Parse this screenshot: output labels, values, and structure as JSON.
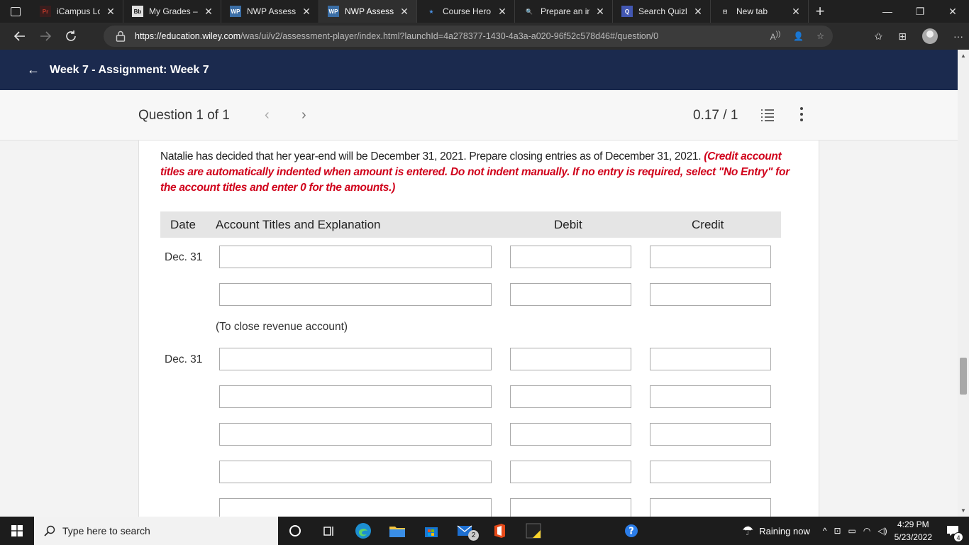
{
  "browser": {
    "tabs": [
      {
        "favicon": "Pr",
        "title": "iCampus Logi",
        "color": "#c0392b",
        "bg": "#3a1d1d",
        "active": false,
        "width": 130
      },
      {
        "favicon": "Bb",
        "title": "My Grades – A",
        "color": "#111",
        "bg": "#e0e0e0",
        "active": false,
        "width": 138
      },
      {
        "favicon": "WP",
        "title": "NWP Assessm",
        "color": "#fff",
        "bg": "#3b6ea5",
        "active": false,
        "width": 138
      },
      {
        "favicon": "WP",
        "title": "NWP Assessm",
        "color": "#fff",
        "bg": "#3b6ea5",
        "active": true,
        "width": 138
      },
      {
        "favicon": "★",
        "title": "Course Hero",
        "color": "#4a90e2",
        "bg": "transparent",
        "active": false,
        "width": 138
      },
      {
        "favicon": "🔍",
        "title": "Prepare an in",
        "color": "#6ab0ff",
        "bg": "transparent",
        "active": false,
        "width": 138
      },
      {
        "favicon": "Q",
        "title": "Search Quizle",
        "color": "#fff",
        "bg": "#4257b2",
        "active": false,
        "width": 138
      },
      {
        "favicon": "⊟",
        "title": "New tab",
        "color": "#ddd",
        "bg": "transparent",
        "active": false,
        "width": 138
      }
    ],
    "url_host": "https://education.wiley.com",
    "url_path": "/was/ui/v2/assessment-player/index.html?launchId=4a278377-1430-4a3a-a020-96f52c578d46#/question/0"
  },
  "assignment": {
    "title": "Week 7 - Assignment: Week 7"
  },
  "question_bar": {
    "question_label": "Question 1 of 1",
    "score": "0.17 / 1"
  },
  "question": {
    "prompt": "Natalie has decided that her year-end will be December 31, 2021. Prepare closing entries as of December 31, 2021.",
    "hint": "(Credit account titles are automatically indented when amount is entered. Do not indent manually. If no entry is required, select \"No Entry\" for the account titles and enter 0 for the amounts.)"
  },
  "table": {
    "headers": {
      "date": "Date",
      "account": "Account Titles and Explanation",
      "debit": "Debit",
      "credit": "Credit"
    },
    "entries": [
      {
        "date": "Dec. 31",
        "note": "(To close revenue account)"
      },
      {
        "date": "Dec. 31"
      }
    ]
  },
  "taskbar": {
    "search_placeholder": "Type here to search",
    "weather": "Raining now",
    "time": "4:29 PM",
    "date": "5/23/2022",
    "mail_badge": "2",
    "notif_badge": "4"
  }
}
